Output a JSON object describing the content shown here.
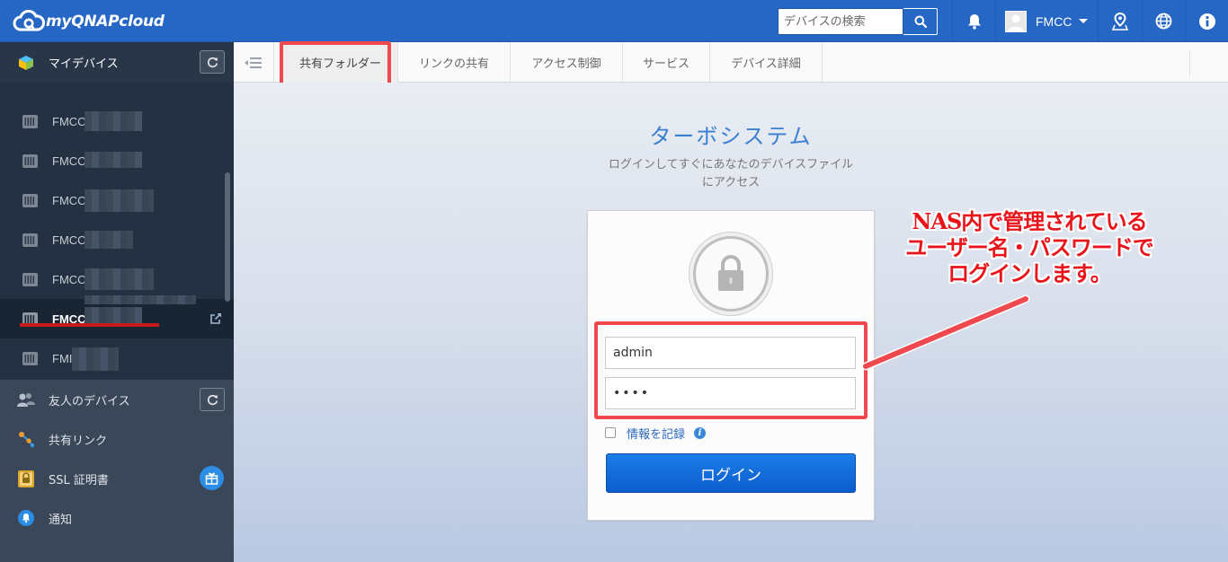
{
  "app": {
    "logo_text": "myQNAPcloud"
  },
  "header": {
    "search_placeholder": "デバイスの検索",
    "user_name": "FMCC",
    "icons": [
      "search-icon",
      "bell-icon",
      "location-pin-icon",
      "globe-icon",
      "info-icon"
    ]
  },
  "sidebar": {
    "my_devices_label": "マイデバイス",
    "devices": [
      {
        "name": "FMCC"
      },
      {
        "name": "FMCC"
      },
      {
        "name": "FMCC"
      },
      {
        "name": "FMCC"
      },
      {
        "name": "FMCC"
      },
      {
        "name": "FMCC",
        "active": true
      },
      {
        "name": "FMI"
      }
    ],
    "friends_devices_label": "友人のデバイス",
    "shared_links_label": "共有リンク",
    "ssl_label": "SSL 証明書",
    "notifications_label": "通知"
  },
  "tabs": [
    {
      "label": "共有フォルダー",
      "active": true
    },
    {
      "label": "リンクの共有"
    },
    {
      "label": "アクセス制御"
    },
    {
      "label": "サービス"
    },
    {
      "label": "デバイス詳細"
    }
  ],
  "login": {
    "title": "ターボシステム",
    "subtitle_line1": "ログインしてすぐにあなたのデバイスファイル",
    "subtitle_line2": "にアクセス",
    "username_value": "admin",
    "password_value": "••••",
    "remember_label": "情報を記録",
    "login_button": "ログイン"
  },
  "annotation": {
    "line1": "NAS内で管理されている",
    "line2": "ユーザー名・パスワードで",
    "line3": "ログインします。"
  },
  "colors": {
    "header_blue": "#2667c5",
    "accent_red": "#f0484f",
    "annotation_red": "#e8141a",
    "sidebar_dark": "#243142"
  }
}
